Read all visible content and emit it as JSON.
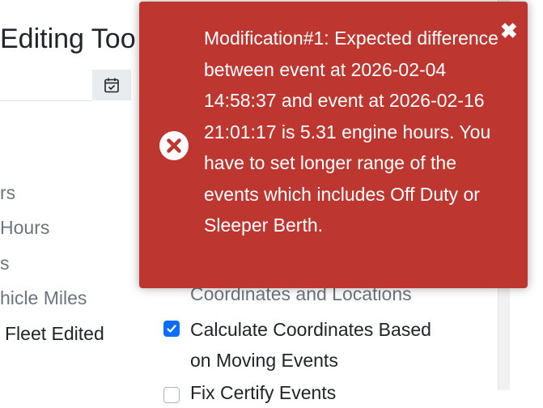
{
  "header": {
    "title": "Editing Too"
  },
  "icons": {
    "calendar": "calendar-check-icon",
    "toast_error": "times-circle-icon",
    "toast_close": "close-icon"
  },
  "sidebar": {
    "items": [
      {
        "label": "rs"
      },
      {
        "label": "Hours"
      },
      {
        "label": "s"
      },
      {
        "label": "hicle Miles"
      },
      {
        "label": "Fleet Edited"
      }
    ]
  },
  "options": {
    "section_label": "Coordinates and Locations",
    "calc_coords": {
      "line1": "Calculate Coordinates Based",
      "line2": "on Moving Events",
      "checked": true
    },
    "fix_certify": {
      "label": "Fix Certify Events",
      "checked": false
    }
  },
  "toast": {
    "message": "Modification#1: Expected difference between event at 2026-02-04 14:58:37 and event at 2026-02-16 21:01:17 is 5.31 engine hours. You have to set longer range of the events which includes Off Duty or Sleeper Berth.",
    "close_symbol": "✖",
    "bg_color": "#bd362f"
  },
  "colors": {
    "checkbox_accent": "#0d6efd",
    "muted_text": "#6c757d"
  }
}
